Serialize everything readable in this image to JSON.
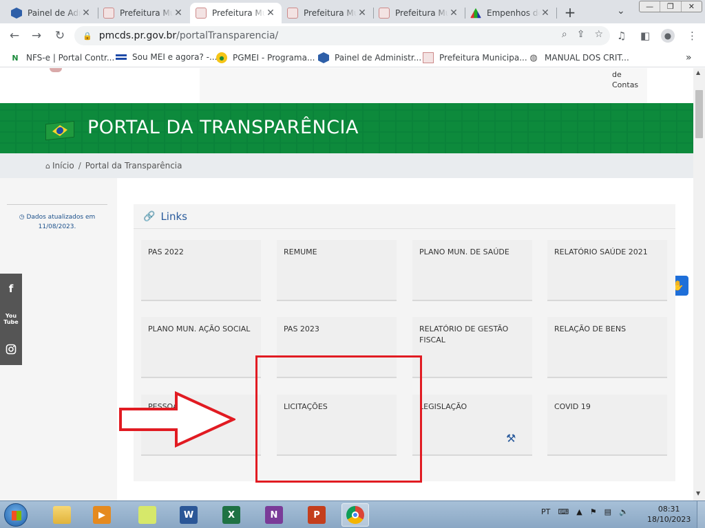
{
  "browser": {
    "tabs": [
      {
        "title": "Painel de Administração",
        "favicon": "hex-blue-icon",
        "active": false
      },
      {
        "title": "Prefeitura Municipal",
        "favicon": "crest-icon",
        "active": false
      },
      {
        "title": "Prefeitura Municipal",
        "favicon": "crest-icon",
        "active": true
      },
      {
        "title": "Prefeitura Municipal",
        "favicon": "crest-icon",
        "active": false
      },
      {
        "title": "Prefeitura Municipal",
        "favicon": "crest-icon",
        "active": false
      },
      {
        "title": "Empenhos do",
        "favicon": "triangle-icon",
        "active": false
      }
    ],
    "close_glyph": "✕",
    "newtab_glyph": "+",
    "url_domain": "pmcds.pr.gov.br",
    "url_path": "/portalTransparencia/",
    "bookmarks": [
      {
        "label": "NFS-e | Portal Contr..."
      },
      {
        "label": "Sou MEI e agora? -..."
      },
      {
        "label": "PGMEI - Programa..."
      },
      {
        "label": "Painel de Administr..."
      },
      {
        "label": "Prefeitura Municipa..."
      },
      {
        "label": "MANUAL DOS CRIT..."
      }
    ],
    "bookmarks_more": "»"
  },
  "page": {
    "header_contas": [
      "de",
      "Contas"
    ],
    "banner_title": "PORTAL DA TRANSPARÊNCIA",
    "breadcrumb": {
      "home": "Início",
      "separator": "/",
      "current": "Portal da Transparência"
    },
    "updated_label": "Dados atualizados em",
    "updated_date": "11/08/2023.",
    "links_title": "Links",
    "cards": [
      {
        "label": "PAS 2022"
      },
      {
        "label": "REMUME"
      },
      {
        "label": "PLANO MUN. DE SAÚDE"
      },
      {
        "label": "RELATÓRIO SAÚDE 2021"
      },
      {
        "label": "PLANO MUN. AÇÃO SOCIAL"
      },
      {
        "label": "PAS 2023"
      },
      {
        "label": "RELATÓRIO DE GESTÃO FISCAL"
      },
      {
        "label": "RELAÇÃO DE BENS"
      },
      {
        "label": "PESSOAL"
      },
      {
        "label": "LICITAÇÕES"
      },
      {
        "label": "LEGISLAÇÃO"
      },
      {
        "label": "COVID 19"
      }
    ],
    "social": [
      "f",
      "You Tube",
      "instagram"
    ]
  },
  "taskbar": {
    "language": "PT",
    "time": "08:31",
    "date": "18/10/2023"
  },
  "colors": {
    "banner_green": "#0d8a3c",
    "link_blue": "#2a5b9c",
    "annotation_red": "#e11b22",
    "accessibility_blue": "#1e6fd9"
  }
}
